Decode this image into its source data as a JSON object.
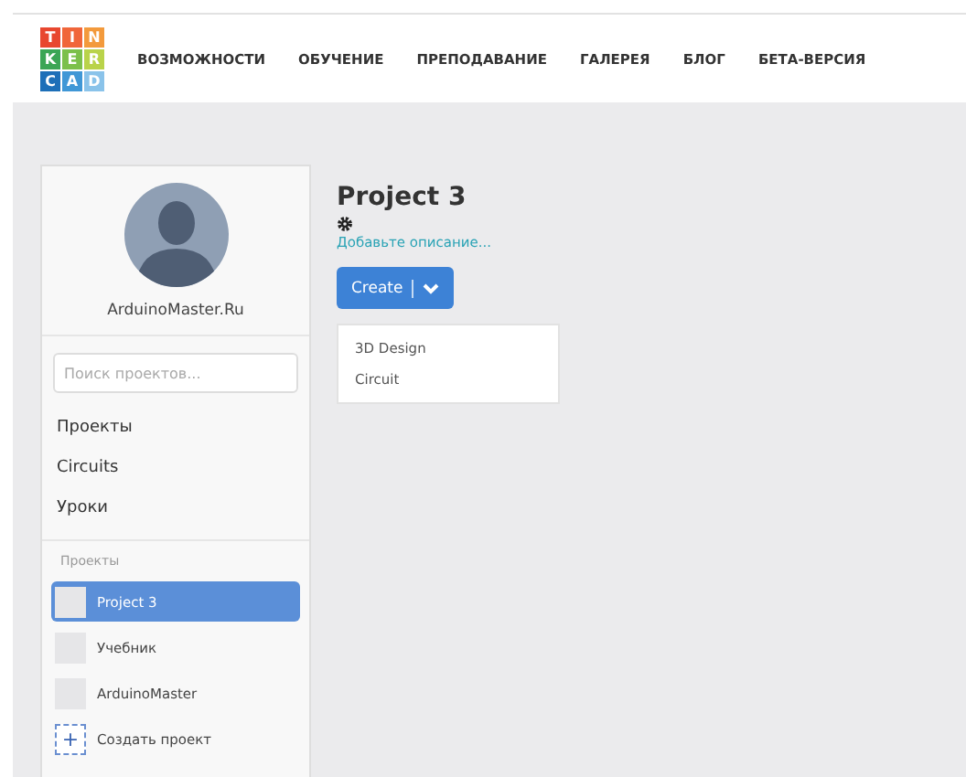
{
  "logo": {
    "tiles": [
      {
        "letter": "T",
        "color": "#e8472f"
      },
      {
        "letter": "I",
        "color": "#f0663a"
      },
      {
        "letter": "N",
        "color": "#f39a3c"
      },
      {
        "letter": "K",
        "color": "#3ba555"
      },
      {
        "letter": "E",
        "color": "#7cc04b"
      },
      {
        "letter": "R",
        "color": "#b9d34a"
      },
      {
        "letter": "C",
        "color": "#1d6fb8"
      },
      {
        "letter": "A",
        "color": "#3f97d6"
      },
      {
        "letter": "D",
        "color": "#8ac3ea"
      }
    ]
  },
  "nav": [
    "ВОЗМОЖНОСТИ",
    "ОБУЧЕНИЕ",
    "ПРЕПОДАВАНИЕ",
    "ГАЛЕРЕЯ",
    "БЛОГ",
    "БЕТА-ВЕРСИЯ"
  ],
  "sidebar": {
    "user_name": "ArduinoMaster.Ru",
    "search": {
      "placeholder": "Поиск проектов..."
    },
    "links": [
      "Проекты",
      "Circuits",
      "Уроки"
    ],
    "projects_heading": "Проекты",
    "projects": [
      {
        "name": "Project 3",
        "selected": true
      },
      {
        "name": "Учебник",
        "selected": false
      },
      {
        "name": "ArduinoMaster",
        "selected": false
      }
    ],
    "create_project": {
      "icon": "+",
      "label": "Создать проект"
    }
  },
  "project": {
    "title": "Project 3",
    "description_link": "Добавьте описание...",
    "create_button": {
      "label": "Create",
      "expanded": true
    },
    "create_menu": [
      "3D Design",
      "Circuit"
    ]
  }
}
